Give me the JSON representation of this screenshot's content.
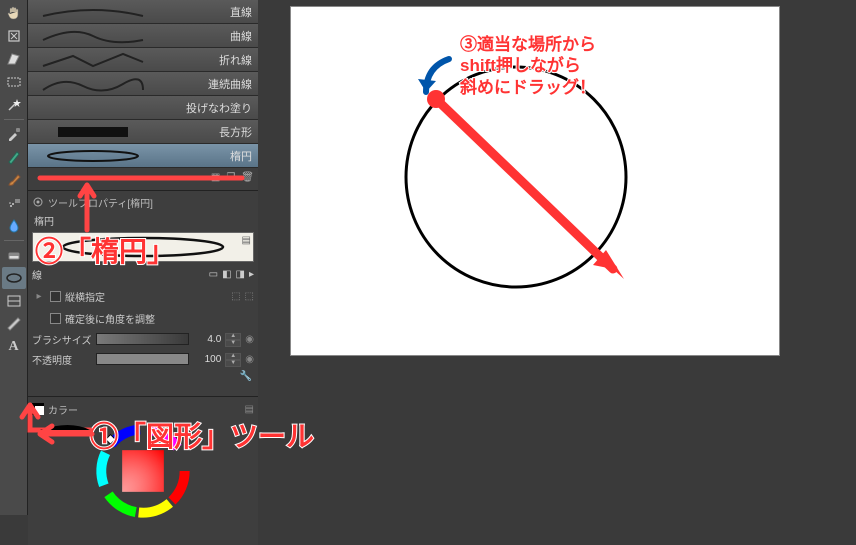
{
  "toolbar": {
    "tools": [
      {
        "name": "pan-tool-icon",
        "glyph": "✋"
      },
      {
        "name": "move-tool-icon",
        "glyph": "⬚"
      },
      {
        "name": "lasso-tool-icon",
        "glyph": "✦"
      },
      {
        "name": "marquee-tool-icon",
        "glyph": "▭"
      },
      {
        "name": "wand-tool-icon",
        "glyph": "✧"
      },
      {
        "name": "eyedropper-tool-icon",
        "glyph": "◐"
      },
      {
        "name": "pen-tool-icon",
        "glyph": "✒"
      },
      {
        "name": "brush-tool-icon",
        "glyph": "🖌"
      },
      {
        "name": "airbrush-tool-icon",
        "glyph": "⛆"
      },
      {
        "name": "blend-tool-icon",
        "glyph": "💧"
      },
      {
        "name": "eraser-tool-icon",
        "glyph": "◧"
      },
      {
        "name": "shape-tool-icon",
        "glyph": "⬭",
        "selected": true
      },
      {
        "name": "frame-tool-icon",
        "glyph": "▢"
      },
      {
        "name": "ruler-tool-icon",
        "glyph": "📐"
      },
      {
        "name": "text-tool-icon",
        "glyph": "A"
      }
    ]
  },
  "subtools": {
    "items": [
      {
        "label": "直線",
        "kind": "line"
      },
      {
        "label": "曲線",
        "kind": "curve"
      },
      {
        "label": "折れ線",
        "kind": "polyline"
      },
      {
        "label": "連続曲線",
        "kind": "cont-curve"
      },
      {
        "label": "投げなわ塗り",
        "kind": "lasso-fill"
      },
      {
        "label": "長方形",
        "kind": "rect"
      },
      {
        "label": "楕円",
        "kind": "ellipse",
        "selected": true
      }
    ]
  },
  "property": {
    "panel_title": "ツールプロパティ[楕円]",
    "name": "楕円",
    "line_toggle": "線",
    "aspect_lock": "縦横指定",
    "angle_after": "確定後に角度を調整",
    "brush_size_label": "ブラシサイズ",
    "brush_size_value": "4.0",
    "opacity_label": "不透明度",
    "opacity_value": "100"
  },
  "color": {
    "panel_title": "カラー"
  },
  "annotations": {
    "step1": "①「図形」ツール",
    "step2": "②「楕円」",
    "step3_line1": "③適当な場所から",
    "step3_line2": "shift押しながら",
    "step3_line3": "斜めにドラッグ！"
  }
}
